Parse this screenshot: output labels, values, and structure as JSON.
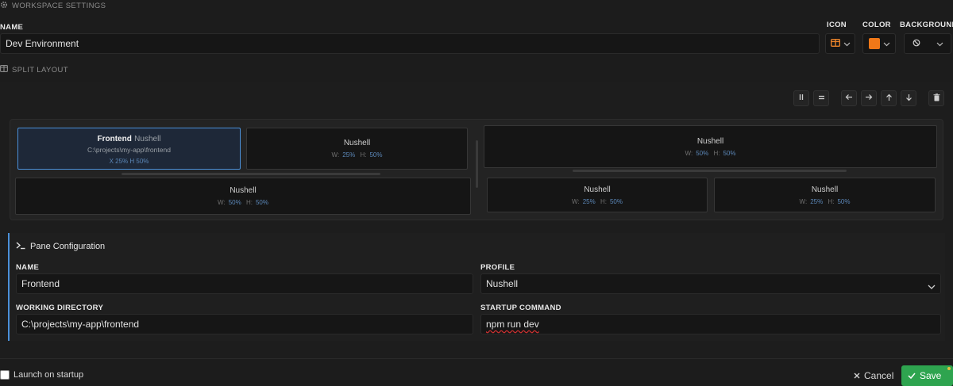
{
  "workspace_settings": {
    "title": "WORKSPACE SETTINGS",
    "icon": "gear-icon"
  },
  "name_field": {
    "label": "NAME",
    "value": "Dev Environment"
  },
  "icon_picker": {
    "label": "ICON",
    "icon": "split-layout-icon",
    "color": "#e8822a"
  },
  "color_picker": {
    "label": "COLOR",
    "value": "#f07818"
  },
  "background_picker": {
    "label": "BACKGROUND",
    "icon": "no-background-icon"
  },
  "split_layout": {
    "title": "SPLIT LAYOUT",
    "icon": "columns-icon"
  },
  "toolbar": [
    "split-vertical-icon",
    "split-horizontal-icon",
    "arrow-left-icon",
    "arrow-right-icon",
    "arrow-up-icon",
    "arrow-down-icon",
    "trash-icon"
  ],
  "panes": [
    {
      "title": "Frontend",
      "profile": "Nushell",
      "dir": "C:\\projects\\my-app\\frontend",
      "dim": "X 25% H 50%",
      "selected": true
    },
    {
      "profile": "Nushell",
      "w_label": "W:",
      "w": "25%",
      "h_label": "H:",
      "h": "50%"
    },
    {
      "profile": "Nushell",
      "w_label": "W:",
      "w": "50%",
      "h_label": "H:",
      "h": "50%"
    },
    {
      "profile": "Nushell",
      "w_label": "W:",
      "w": "50%",
      "h_label": "H:",
      "h": "50%"
    },
    {
      "profile": "Nushell",
      "w_label": "W:",
      "w": "25%",
      "h_label": "H:",
      "h": "50%"
    },
    {
      "profile": "Nushell",
      "w_label": "W:",
      "w": "25%",
      "h_label": "H:",
      "h": "50%"
    }
  ],
  "pane_config": {
    "title": "Pane Configuration",
    "name": {
      "label": "NAME",
      "value": "Frontend"
    },
    "profile": {
      "label": "PROFILE",
      "value": "Nushell"
    },
    "working_directory": {
      "label": "WORKING DIRECTORY",
      "value": "C:\\projects\\my-app\\frontend"
    },
    "startup_command": {
      "label": "STARTUP COMMAND",
      "value": "npm run dev"
    }
  },
  "footer": {
    "launch_on_startup": "Launch on startup",
    "checked": false,
    "cancel": "Cancel",
    "save": "Save"
  },
  "colors": {
    "accent": "#4a90d9",
    "save": "#2ea44f"
  }
}
